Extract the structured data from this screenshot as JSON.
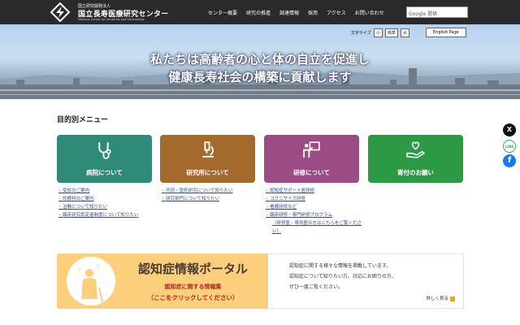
{
  "header": {
    "org_small": "国立研究開発法人",
    "org_name": "国立長寿医療研究センター",
    "org_en": "National Center for Geriatrics and Gerontology",
    "nav": [
      "センター概要",
      "研究の推進",
      "調達情報",
      "採用",
      "アクセス",
      "お問い合わせ"
    ],
    "search_placeholder": "Google 提供"
  },
  "hero": {
    "font_size_label": "文字サイズ",
    "sizes": [
      "小",
      "標準",
      "大"
    ],
    "english": "English Page",
    "line1": "私たちは高齢者の心と体の自立を促進し",
    "line2": "健康長寿社会の構築に貢献します"
  },
  "menu": {
    "title": "目的別メニュー",
    "cards": [
      {
        "label": "病院について",
        "color": "#2f8a78",
        "icon": "stethoscope-icon",
        "links": [
          "受診のご案内",
          "診療科のご案内",
          "治験について知りたい",
          "臨床研究認定者制度について知りたい"
        ]
      },
      {
        "label": "研究所について",
        "color": "#a4692d",
        "icon": "microscope-icon",
        "links": [
          "共同・受託研究について知りたい",
          "研究部門について知りたい"
        ]
      },
      {
        "label": "研修について",
        "color": "#9c4c84",
        "icon": "lecture-icon",
        "links": [
          "認知症サポート医研修",
          "コグニサイズ研修",
          "看護研修など",
          "臨床研修・専門研修プログラム"
        ],
        "link_note": "（研修医・専攻医の方はこちらをご覧ください）"
      },
      {
        "label": "寄付のお願い",
        "color": "#2c9945",
        "icon": "donation-hand-icon",
        "links": []
      }
    ]
  },
  "banner": {
    "title": "認知症情報ポータル",
    "sub": "認知症に関する情報集",
    "sub2": "（ここをクリックしてください）",
    "desc": [
      "認知症に関する様々な情報を掲載しています。",
      "認知症について知りたい方、対応にお困りの方、",
      "ぜひ一度ご覧ください。"
    ],
    "more": "詳しく見る"
  },
  "social": [
    "X",
    "LINE",
    "f"
  ]
}
